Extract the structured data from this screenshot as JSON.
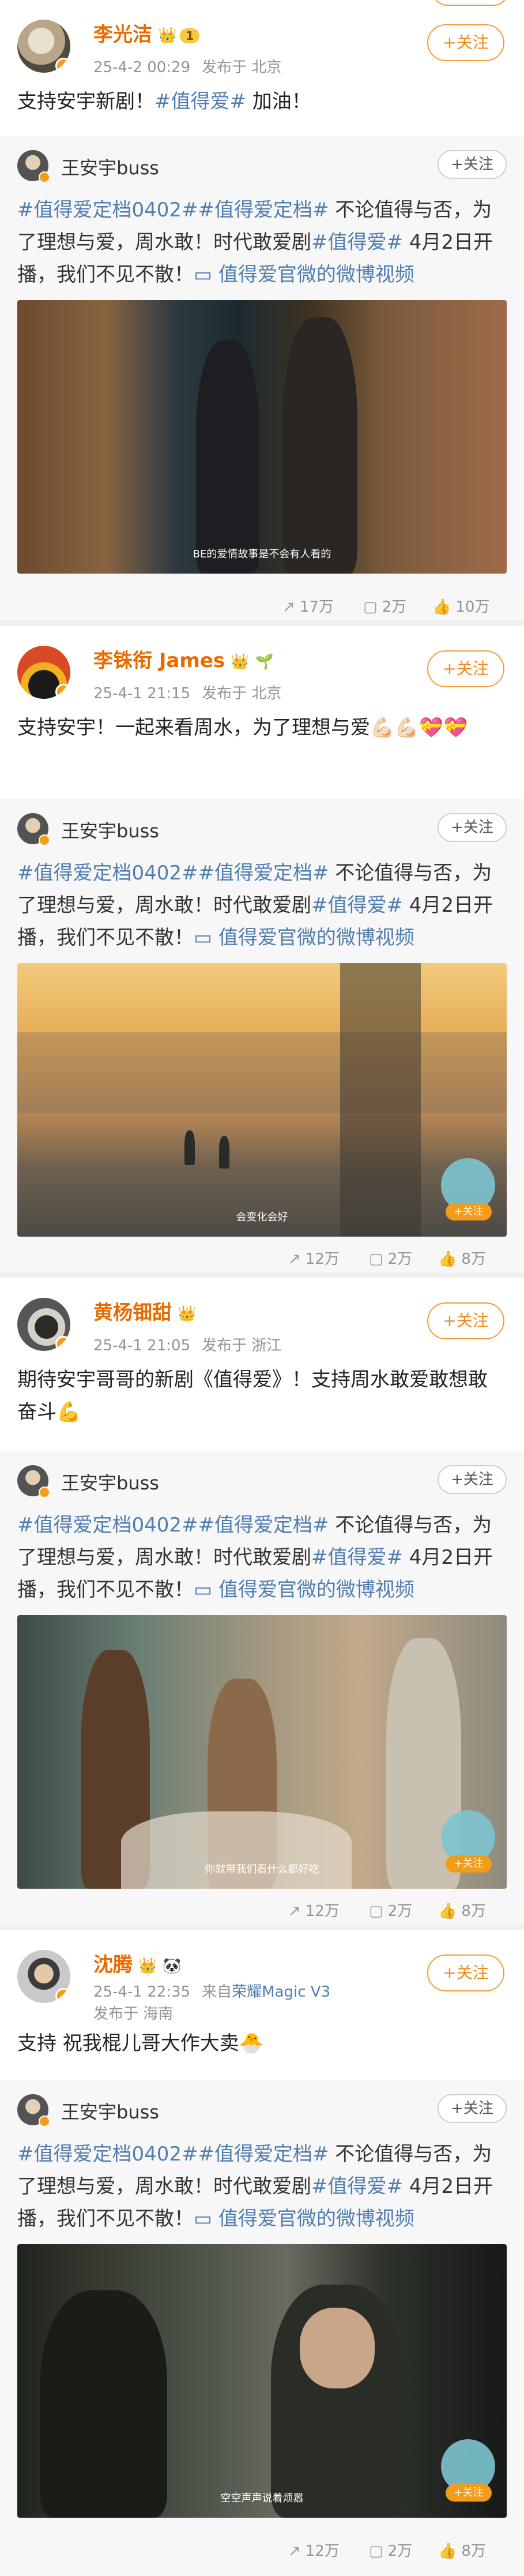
{
  "original_post": {
    "author": "王安宇buss",
    "follow_label": "+关注",
    "text_tag1": "#值得爱定档0402#",
    "text_tag2": "#值得爱定档#",
    "text_mid": " 不论值得与否，为了理想与爱，周水敢！时代敢爱剧",
    "text_tag3": "#值得爱#",
    "text_end": " 4月2日开播，我们不见不散！",
    "video_link": "值得爱官微的微博视频"
  },
  "posts": [
    {
      "user": "李光洁",
      "level": "1",
      "time": "25-4-2 00:29",
      "location": "发布于 北京",
      "follow_label": "+关注",
      "text": "支持安宇新剧！",
      "text_tag": "#值得爱#",
      "text_after": " 加油！",
      "caption": "BE的爱情故事是不会有人看的",
      "reposts": "17万",
      "comments": "2万",
      "likes": "10万"
    },
    {
      "user": "李铢衔 James",
      "time": "25-4-1 21:15",
      "location": "发布于 北京",
      "follow_label": "+关注",
      "text": "支持安宇！一起来看周水，为了理想与爱💪🏻💪🏻💝💝",
      "caption": "会变化会好",
      "watermark_follow": "+关注",
      "reposts": "12万",
      "comments": "2万",
      "likes": "8万"
    },
    {
      "user": "黄杨钿甜",
      "time": "25-4-1 21:05",
      "location": "发布于 浙江",
      "follow_label": "+关注",
      "text": "期待安宇哥哥的新剧《值得爱》！支持周水敢爱敢想敢奋斗💪",
      "caption": "你就带我们看什么都好吃",
      "watermark_follow": "+关注",
      "reposts": "12万",
      "comments": "2万",
      "likes": "8万"
    },
    {
      "user": "沈腾",
      "time": "25-4-1 22:35",
      "source_prefix": "来自",
      "source": "荣耀Magic V3",
      "location": "发布于 海南",
      "follow_label": "+关注",
      "text": "支持 祝我棍儿哥大作大卖🐣",
      "caption": "空空声声说着烦嚣",
      "watermark_follow": "+关注",
      "reposts": "12万",
      "comments": "2万",
      "likes": "8万"
    }
  ],
  "icons": {
    "repost": "repost-icon",
    "comment": "comment-icon",
    "like": "like-icon",
    "verified": "verified-badge-icon",
    "crown": "crown-icon"
  },
  "colors": {
    "accent_orange": "#f08a1a",
    "link_blue": "#507daf",
    "meta_gray": "#939393"
  }
}
